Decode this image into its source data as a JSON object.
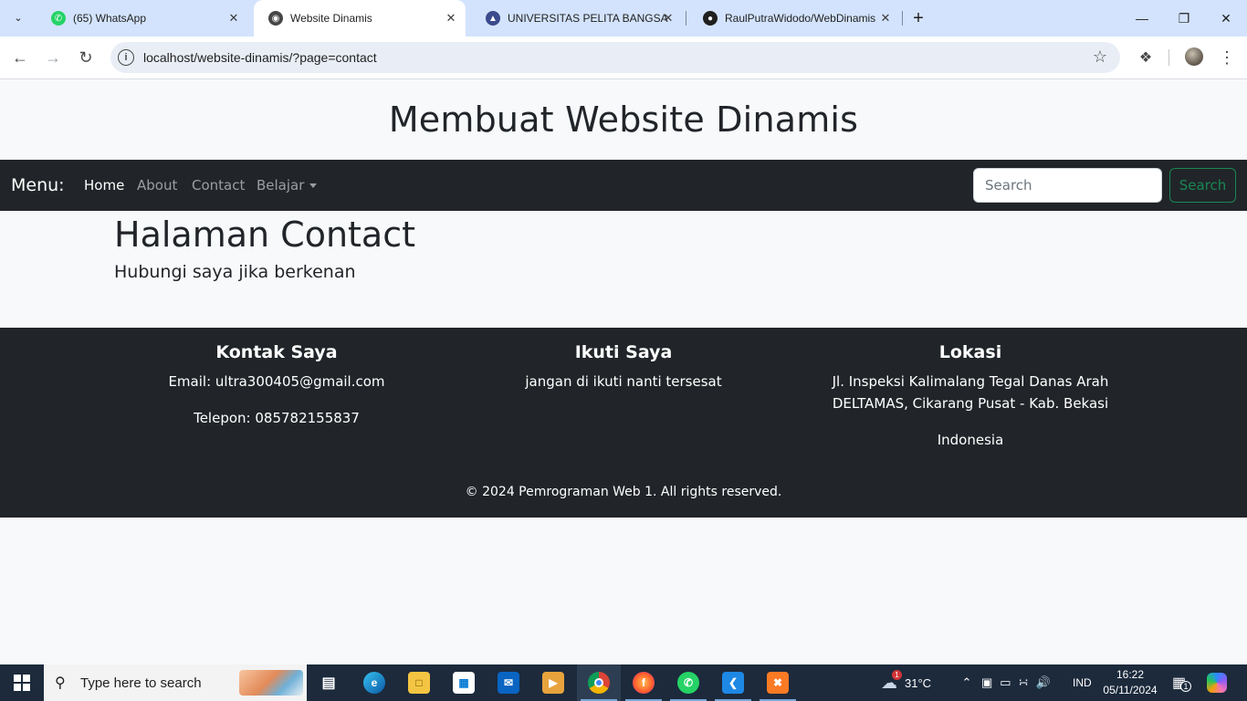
{
  "browser": {
    "tabs": [
      {
        "title": "(65) WhatsApp",
        "active": false,
        "favicon": "whatsapp-icon"
      },
      {
        "title": "Website Dinamis",
        "active": true,
        "favicon": "globe-icon"
      },
      {
        "title": "UNIVERSITAS PELITA BANGSA",
        "active": false,
        "favicon": "university-icon"
      },
      {
        "title": "RaulPutraWidodo/WebDinamis",
        "active": false,
        "favicon": "github-icon"
      }
    ],
    "url": "localhost/website-dinamis/?page=contact"
  },
  "site": {
    "title": "Membuat Website Dinamis",
    "nav": {
      "brand": "Menu:",
      "links": [
        "Home",
        "About",
        "Contact",
        "Belajar"
      ],
      "search_placeholder": "Search",
      "search_button": "Search"
    },
    "content": {
      "heading": "Halaman Contact",
      "subheading": "Hubungi saya jika berkenan"
    },
    "footer": {
      "contact": {
        "title": "Kontak Saya",
        "email": "Email: ultra300405@gmail.com",
        "phone": "Telepon: 085782155837"
      },
      "follow": {
        "title": "Ikuti Saya",
        "text": "jangan di ikuti nanti tersesat"
      },
      "location": {
        "title": "Lokasi",
        "line1": "Jl. Inspeksi Kalimalang Tegal Danas Arah",
        "line2": "DELTAMAS, Cikarang Pusat - Kab. Bekasi",
        "country": "Indonesia"
      },
      "copyright": "© 2024 Pemrograman Web 1. All rights reserved."
    }
  },
  "taskbar": {
    "search_placeholder": "Type here to search",
    "weather_temp": "31°C",
    "weather_badge": "1",
    "language": "IND",
    "time": "16:22",
    "date": "05/11/2024",
    "notification_count": "1"
  },
  "colors": {
    "navbar_bg": "#212529",
    "page_bg": "#f8f9fa",
    "search_green": "#198754",
    "tabstrip_bg": "#d3e3fd"
  }
}
